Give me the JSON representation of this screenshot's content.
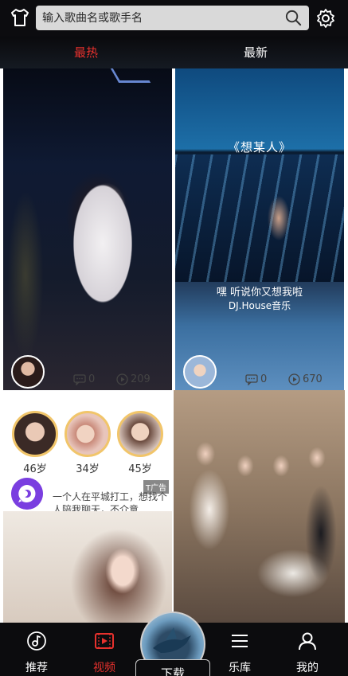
{
  "search": {
    "placeholder": "输入歌曲名或歌手名"
  },
  "tabs": [
    {
      "label": "最热",
      "active": true
    },
    {
      "label": "最新",
      "active": false
    }
  ],
  "feed": {
    "cards": [
      {
        "comments": "0",
        "plays": "209"
      },
      {
        "title": "《想某人》",
        "caption_line1": "嘿 听说你又想我啦",
        "caption_line2": "DJ.House音乐",
        "comments": "0",
        "plays": "670"
      }
    ],
    "ad": {
      "profiles": [
        {
          "age": "46岁"
        },
        {
          "age": "34岁"
        },
        {
          "age": "45岁"
        }
      ],
      "tag": "T广告",
      "text": "一个人在平城打工，想找个人陪我聊天，不介意..."
    }
  },
  "bottom_nav": {
    "items": [
      {
        "label": "推荐",
        "icon": "music-note-disc-icon"
      },
      {
        "label": "视频",
        "icon": "video-play-icon",
        "active": true
      },
      {
        "label": "乐库",
        "icon": "menu-lines-icon"
      },
      {
        "label": "我的",
        "icon": "person-icon"
      }
    ],
    "center_label": "下载"
  },
  "colors": {
    "accent": "#e7312d",
    "background": "#000000",
    "search_bg": "#d9d9d9"
  }
}
